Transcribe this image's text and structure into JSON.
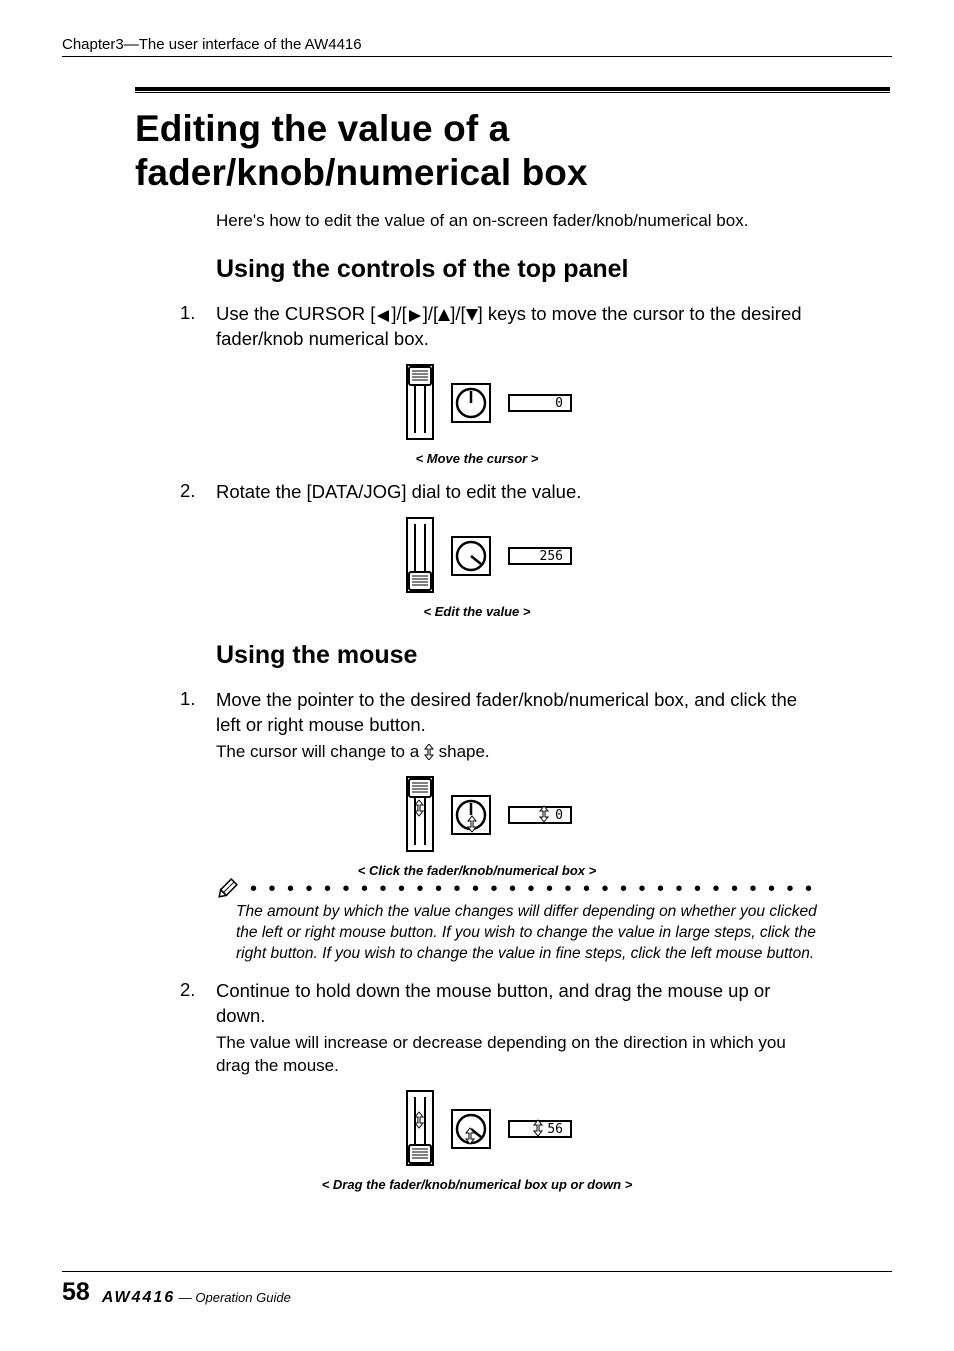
{
  "chapter_header": "Chapter3—The user interface of the AW4416",
  "main_title": "Editing the value of a fader/knob/numerical box",
  "intro": "Here's how to edit the value of an on-screen fader/knob/numerical box.",
  "section1": {
    "title": "Using the controls of the top panel",
    "step1": {
      "num": "1.",
      "head_pre": "Use the CURSOR [",
      "head_mid1": "]/[",
      "head_mid2": "]/[",
      "head_mid3": "]/[",
      "head_post": "] keys to move the cursor to the desired fader/knob numerical box."
    },
    "fig1": {
      "caption": "< Move the cursor >",
      "value": "0"
    },
    "step2": {
      "num": "2.",
      "head": "Rotate the [DATA/JOG] dial to edit the value."
    },
    "fig2": {
      "caption": "< Edit the value >",
      "value": "256"
    }
  },
  "section2": {
    "title": "Using the mouse",
    "step1": {
      "num": "1.",
      "head": "Move the pointer to the desired fader/knob/numerical box, and click the left or right mouse button.",
      "sub_pre": "The cursor will change to a ",
      "sub_post": " shape."
    },
    "fig3": {
      "caption": "< Click the fader/knob/numerical box >",
      "value": "0"
    },
    "note": "The amount by which the value changes will differ depending on whether you clicked the left or right mouse button. If you wish to change the value in large steps, click the right button. If you wish to change the value in fine steps, click the left mouse button.",
    "step2": {
      "num": "2.",
      "head": "Continue to hold down the mouse button, and drag the mouse up or down.",
      "sub": "The value will increase or decrease depending on the direction in which you drag the mouse."
    },
    "fig4": {
      "caption": "< Drag the fader/knob/numerical box up or down >",
      "value": "56"
    }
  },
  "footer": {
    "page": "58",
    "logo": "AW4416",
    "guide": " — Operation Guide"
  }
}
